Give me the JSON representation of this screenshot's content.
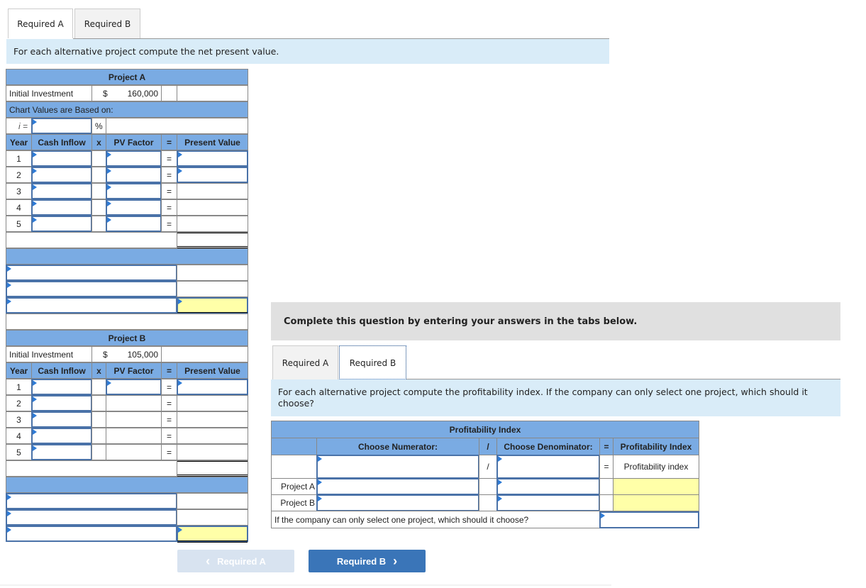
{
  "top_tabs": [
    {
      "label": "Required A",
      "active": true
    },
    {
      "label": "Required B",
      "active": false
    }
  ],
  "top_instruction": "For each alternative project compute the net present value.",
  "project_a": {
    "title": "Project A",
    "initial_investment_label": "Initial Investment",
    "currency": "$",
    "initial_investment": "160,000",
    "chart_values_label": "Chart Values are Based on:",
    "i_label": "i =",
    "percent": "%",
    "columns": [
      "Year",
      "Cash Inflow",
      "x",
      "PV Factor",
      "=",
      "Present Value"
    ],
    "years": [
      "1",
      "2",
      "3",
      "4",
      "5"
    ],
    "eq": "="
  },
  "project_b": {
    "title": "Project B",
    "initial_investment_label": "Initial Investment",
    "currency": "$",
    "initial_investment": "105,000",
    "columns": [
      "Year",
      "Cash Inflow",
      "x",
      "PV Factor",
      "=",
      "Present Value"
    ],
    "years": [
      "1",
      "2",
      "3",
      "4",
      "5"
    ],
    "eq": "="
  },
  "nav": {
    "prev_label": "Required A",
    "next_label": "Required B",
    "prev_icon": "‹",
    "next_icon": "›"
  },
  "banner": "Complete this question by entering your answers in the tabs below.",
  "inner_tabs": [
    {
      "label": "Required A",
      "active": false
    },
    {
      "label": "Required B",
      "active": true
    }
  ],
  "inner_instruction": "For each alternative project compute the profitability index. If the company can only select one project, which should it choose?",
  "pi_table": {
    "title": "Profitability Index",
    "numerator_header": "Choose Numerator:",
    "slash": "/",
    "denominator_header": "Choose Denominator:",
    "eq": "=",
    "result_header": "Profitability Index",
    "result_row_label": "Profitability index",
    "rows": [
      "Project A",
      "Project B"
    ],
    "question": "If the company can only select one project, which should it choose?"
  }
}
